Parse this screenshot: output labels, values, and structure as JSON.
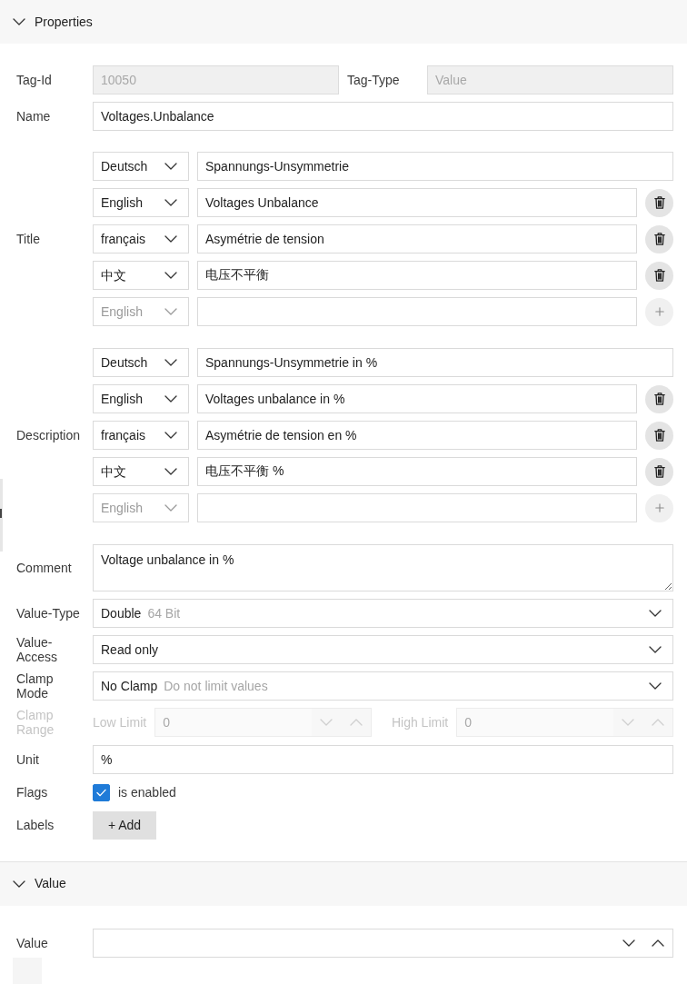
{
  "sections": [
    {
      "title": "Properties",
      "expanded": true,
      "fields": [
        {
          "kind": "pair",
          "items": [
            {
              "label": "Tag-Id",
              "value": "10050",
              "disabled": true
            },
            {
              "label": "Tag-Type",
              "value": "Value",
              "disabled": true
            }
          ]
        },
        {
          "kind": "text",
          "label": "Name",
          "value": "Voltages.Unbalance"
        },
        {
          "kind": "translations",
          "label": "Title",
          "entries": [
            {
              "kind": "primary",
              "language": "Deutsch",
              "text": "Spannungs-Unsymmetrie"
            },
            {
              "kind": "extra",
              "language": "English",
              "text": "Voltages Unbalance"
            },
            {
              "kind": "extra",
              "language": "français",
              "text": "Asymétrie de tension"
            },
            {
              "kind": "extra",
              "language": "中文",
              "text": "电压不平衡"
            },
            {
              "kind": "new",
              "language": "English"
            }
          ]
        },
        {
          "kind": "translations",
          "label": "Description",
          "entries": [
            {
              "kind": "primary",
              "language": "Deutsch",
              "text": "Spannungs-Unsymmetrie in %"
            },
            {
              "kind": "extra",
              "language": "English",
              "text": "Voltages unbalance in %"
            },
            {
              "kind": "extra",
              "language": "français",
              "text": "Asymétrie de tension en %"
            },
            {
              "kind": "extra",
              "language": "中文",
              "text": "电压不平衡 %"
            },
            {
              "kind": "new",
              "language": "English"
            }
          ]
        },
        {
          "kind": "textarea",
          "label": "Comment",
          "value": "Voltage unbalance in %"
        },
        {
          "kind": "select",
          "label": "Value-Type",
          "value": "Double",
          "hint": "64 Bit"
        },
        {
          "kind": "select",
          "label": "Value-Access",
          "value": "Read only"
        },
        {
          "kind": "select",
          "label": "Clamp Mode",
          "value": "No Clamp",
          "hint": "Do not limit values"
        },
        {
          "kind": "range",
          "label": "Clamp Range",
          "disabled": true,
          "limits": [
            {
              "label": "Low Limit",
              "value": "0"
            },
            {
              "label": "High Limit",
              "value": "0"
            }
          ]
        },
        {
          "kind": "text",
          "label": "Unit",
          "value": "%"
        },
        {
          "kind": "checkbox",
          "label": "Flags",
          "text": "is enabled",
          "checked": true
        },
        {
          "kind": "button",
          "label": "Labels",
          "button": "+ Add"
        }
      ]
    },
    {
      "title": "Value",
      "expanded": true,
      "fields": [
        {
          "kind": "spin",
          "label": "Value"
        }
      ]
    }
  ]
}
